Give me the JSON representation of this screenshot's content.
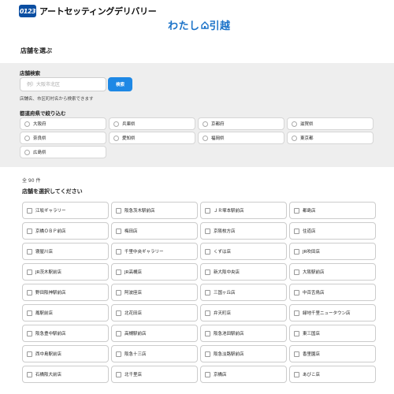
{
  "header": {
    "logo_badge": "0123",
    "logo_text": "アートセッティングデリバリー",
    "brand_pre": "わたし",
    "brand_post": "引越"
  },
  "page": {
    "title": "店舗を選ぶ"
  },
  "search": {
    "label": "店舗検索",
    "placeholder": "例）大阪市北区",
    "value": "",
    "button_label": "検索",
    "hint": "店舗名、市区町村名から検索できます"
  },
  "prefecture": {
    "label": "都道府県で絞り込む",
    "options": [
      "大阪府",
      "兵庫県",
      "京都府",
      "滋賀県",
      "奈良県",
      "愛知県",
      "福岡県",
      "東京都",
      "広島県"
    ]
  },
  "results": {
    "count": "全 90 件",
    "title": "店舗を選択してください",
    "stores": [
      "江坂ギャラリー",
      "阪急茨木駅前店",
      "ＪＲ塚本駅前店",
      "都島店",
      "京橋ＯＢＰ前店",
      "梅田店",
      "京阪枚方店",
      "住道店",
      "寝屋川店",
      "千里中央ギャラリー",
      "くずは店",
      "JR吹田店",
      "JR茨木駅前店",
      "JR高槻店",
      "新大阪中央店",
      "大阪駅前店",
      "野田阪神駅前店",
      "阿波座店",
      "三国ヶ丘店",
      "中百舌鳥店",
      "鳳駅前店",
      "北花田店",
      "弁天町店",
      "緑地千里ニュータウン店",
      "阪急豊中駅前店",
      "高槻駅前店",
      "阪急池田駅前店",
      "東三国店",
      "西中島駅前店",
      "阪急十三店",
      "阪急淡路駅前店",
      "香里園店",
      "石橋阪大前店",
      "北千里店",
      "京橋店",
      "あびこ店"
    ]
  }
}
